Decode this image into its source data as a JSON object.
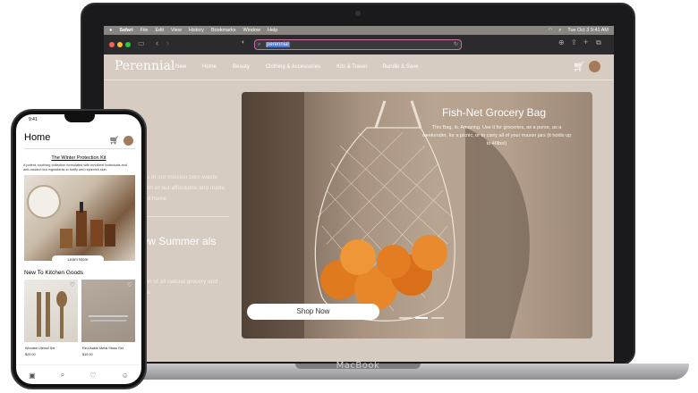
{
  "device": {
    "laptop_label": "MacBook"
  },
  "menubar": {
    "apple": "",
    "items": [
      "Safari",
      "File",
      "Edit",
      "View",
      "History",
      "Bookmarks",
      "Window",
      "Help"
    ],
    "datetime": "Tue Oct 3 9:41 AM"
  },
  "browser": {
    "url": "perennial"
  },
  "site": {
    "logo": "Perennial",
    "nav": [
      "New",
      "Home",
      "Beauty",
      "Clothing & Accessories",
      "Kits & Travel",
      "Bundle & Save"
    ],
    "hero_left": {
      "title_fragment": "me",
      "para1": "r joining us in our mission zero-waste lifestyle with er our affordable and made beauty and home",
      "title2": "l new Summer als",
      "para2": "w collection of all natural grocery and duffel bags"
    },
    "hero": {
      "title": "Fish-Net Grocery Bag",
      "subtitle": "This Bag, Is. Amazing. Use it for groceries, as a purse, as a weekender, for a picnic, or to carry all of your mason jars (it holds up to 40lbs!)",
      "button": "Shop Now"
    }
  },
  "phone": {
    "time": "9:41",
    "title": "Home",
    "kit_title": "The Winter Protection Kit",
    "kit_desc": "A potent, soothing collection formulated with emollient botanicals and anti-oxidant rich ingredients to fortify and replenish skin.",
    "learn_more": "Learn More",
    "section": "New To Kitchen Goods",
    "products": [
      {
        "name": "Wooden Utensil Set",
        "price": "$25.00"
      },
      {
        "name": "Re-Usable Metal Straw Set",
        "price": "$15.00"
      }
    ]
  },
  "colors": {
    "site_bg": "#d6ccc2",
    "accent_url_border": "#d56ea6"
  }
}
